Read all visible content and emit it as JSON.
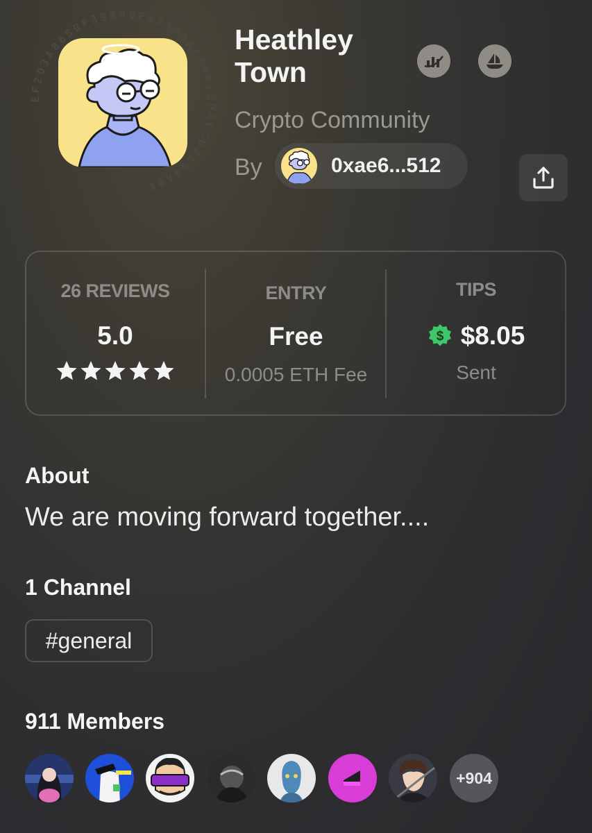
{
  "community": {
    "name": "Heathley Town",
    "category": "Crypto Community",
    "by_label": "By",
    "creator_address": "0xae6...512",
    "ring_text": "EF2D3A865BF39B90E473?DAF6BA12DACCD2C84A0X"
  },
  "stats": {
    "reviews": {
      "label": "26 REVIEWS",
      "value": "5.0",
      "rating": 5
    },
    "entry": {
      "label": "ENTRY",
      "value": "Free",
      "sub": "0.0005 ETH Fee"
    },
    "tips": {
      "label": "TIPS",
      "value": "$8.05",
      "sub": "Sent"
    }
  },
  "about": {
    "title": "About",
    "text": "We are moving forward together...."
  },
  "channels": {
    "title": "1 Channel",
    "items": [
      "#general"
    ]
  },
  "members": {
    "title": "911 Members",
    "more_label": "+904"
  },
  "colors": {
    "accent_green": "#3fc86a",
    "avatar_yellow": "#f8e28a",
    "avatar_blue": "#a9b6f5"
  },
  "icons": [
    "chart-icon",
    "boat-icon",
    "share-icon",
    "dollar-badge-icon",
    "star-icon"
  ]
}
